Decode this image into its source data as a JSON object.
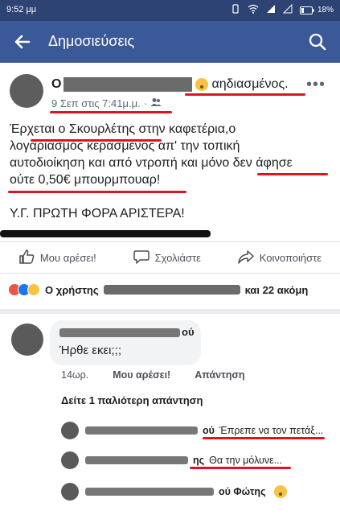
{
  "status_bar": {
    "time": "9:52 μμ",
    "battery": "18%"
  },
  "app_bar": {
    "title": "Δημοσιεύσεις"
  },
  "post": {
    "author_initial": "Ο",
    "feeling": "αηδιασμένος.",
    "timestamp": "9 Σεπ στις 7:41μ.μ.",
    "separator": "·",
    "body_lines": [
      "Έρχεται ο Σκουρλέτης στην καφετέρια,ο",
      "λογαριασμός κερασμένος απ' την τοπική",
      "αυτοδιοίκηση και από ντροπή και μόνο δεν άφησε",
      "ούτε 0,50€ μπουρμπουαρ!"
    ],
    "ps_line": "Υ.Γ. ΠΡΩΤΗ ΦΟΡΑ ΑΡΙΣΤΕΡΑ!",
    "more_icon": "ellipsis-icon"
  },
  "actions": {
    "like": "Μου αρέσει!",
    "comment": "Σχολιάστε",
    "share": "Κοινοποιήστε"
  },
  "reactions": {
    "prefix": "Ο χρήστης",
    "suffix": "και 22 ακόμη",
    "colors": {
      "angry": "#e9573f",
      "like": "#1877f2",
      "haha": "#f7c340"
    }
  },
  "comment": {
    "name_suffix": "ού",
    "text": "Ήρθε εκει;;;",
    "time": "14ωρ.",
    "like": "Μου αρέσει!",
    "reply": "Απάντηση"
  },
  "more_replies": "Δείτε 1 παλιότερη απάντηση",
  "replies": [
    {
      "name_suffix": "ού",
      "text": "Έπρεπε να τον πετάξ..."
    },
    {
      "name_suffix": "ης",
      "text": "Θα την μόλυνε..."
    },
    {
      "name_suffix": "ού Φώτης",
      "text": ""
    }
  ],
  "colors": {
    "fb_blue": "#3b5998",
    "status_bar": "#2d4373",
    "annotation_red": "#e0141e"
  }
}
